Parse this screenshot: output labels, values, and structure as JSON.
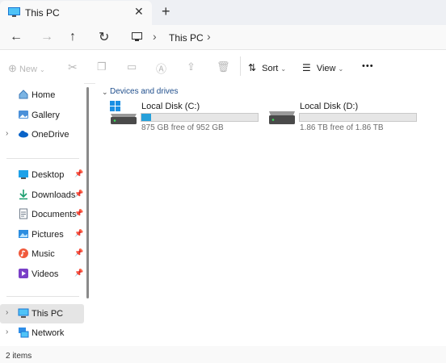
{
  "tab": {
    "title": "This PC",
    "close": "✕",
    "new": "+"
  },
  "nav": {
    "back": "←",
    "forward": "→",
    "up": "↑",
    "refresh": "↻"
  },
  "address": {
    "crumb": "This PC",
    "sep1": "›",
    "sep2": "›"
  },
  "toolbar": {
    "new_label": "New",
    "sort_label": "Sort",
    "view_label": "View",
    "more": "•••"
  },
  "sidebar": {
    "items": [
      {
        "label": "Home",
        "icon": "home-icon"
      },
      {
        "label": "Gallery",
        "icon": "gallery-icon"
      },
      {
        "label": "OneDrive",
        "icon": "onedrive-icon"
      },
      {
        "label": "Desktop",
        "icon": "desktop-icon"
      },
      {
        "label": "Downloads",
        "icon": "downloads-icon"
      },
      {
        "label": "Documents",
        "icon": "documents-icon"
      },
      {
        "label": "Pictures",
        "icon": "pictures-icon"
      },
      {
        "label": "Music",
        "icon": "music-icon"
      },
      {
        "label": "Videos",
        "icon": "videos-icon"
      },
      {
        "label": "This PC",
        "icon": "this-pc-icon"
      },
      {
        "label": "Network",
        "icon": "network-icon"
      }
    ]
  },
  "content": {
    "section_title": "Devices and drives",
    "drives": [
      {
        "name": "Local Disk (C:)",
        "free": "875 GB free of 952 GB",
        "used_fraction": 0.08
      },
      {
        "name": "Local Disk (D:)",
        "free": "1.86 TB free of 1.86 TB",
        "used_fraction": 0.0
      }
    ]
  },
  "status": {
    "items": "2 items"
  },
  "colors": {
    "accent": "#26a0da",
    "selected": "#e5e5e5"
  }
}
